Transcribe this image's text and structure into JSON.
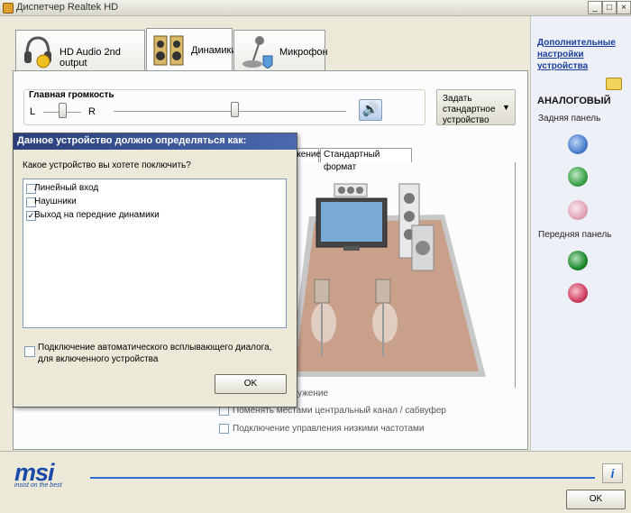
{
  "window": {
    "title": "Диспетчер Realtek HD",
    "controls": [
      "_",
      "□",
      "×"
    ]
  },
  "tabs": [
    {
      "label": "HD Audio 2nd output",
      "icon": "headphones-icon"
    },
    {
      "label": "Динамики",
      "icon": "speakers-icon"
    },
    {
      "label": "Микрофон",
      "icon": "microphone-icon"
    }
  ],
  "volume": {
    "label": "Главная громкость",
    "left": "L",
    "right": "R",
    "balance": 0.5,
    "level": 0.52
  },
  "default_device": {
    "label": "Задать стандартное устройство"
  },
  "subtabs": [
    "ужение",
    "Стандартный формат"
  ],
  "options": [
    {
      "label": "ужение",
      "checked": false
    },
    {
      "label": "Поменять местами центральный канал / сабвуфер",
      "checked": false
    },
    {
      "label": "Подключение управления низкими частотами",
      "checked": false
    }
  ],
  "side": {
    "link": "Дополнительные настройки устройства",
    "heading": "АНАЛОГОВЫЙ",
    "rear_label": "Задняя панель",
    "front_label": "Передняя панель",
    "rear_jacks": [
      "#4d7fd0",
      "#3aa24a",
      "#e3a5b6"
    ],
    "front_jacks": [
      "#1e8a2c",
      "#d04060"
    ]
  },
  "brand": {
    "logo": "msi",
    "slogan": "insist on the best"
  },
  "footer": {
    "ok_label": "OK",
    "info_label": "i"
  },
  "dialog": {
    "title": "Данное устройство должно определяться как:",
    "question": "Какое устройство вы хотете поключить?",
    "items": [
      {
        "label": "Линейный вход",
        "checked": false
      },
      {
        "label": "Наушники",
        "checked": false
      },
      {
        "label": "Выход на передние динамики",
        "checked": true
      }
    ],
    "auto_popup_label": "Подключение автоматического всплывающего диалога, для включенного устройства",
    "auto_popup_checked": false,
    "ok_label": "OK"
  }
}
